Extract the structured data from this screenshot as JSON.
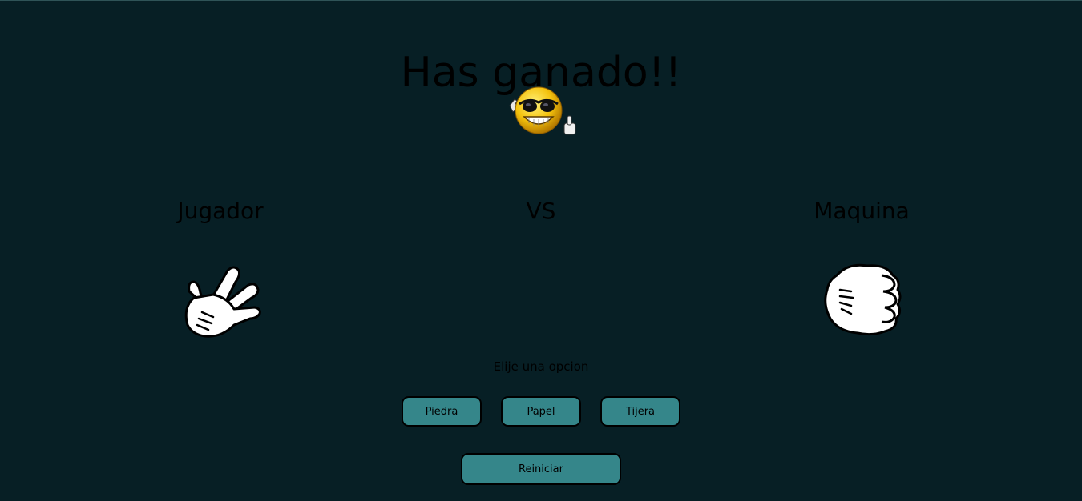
{
  "result": {
    "title": "Has ganado!!",
    "emoji_icon": "cool-sunglasses-thumbs-up-smiley"
  },
  "players": {
    "player_label": "Jugador",
    "vs_label": "VS",
    "machine_label": "Maquina",
    "player_choice_icon": "scissors-hand",
    "machine_choice_icon": "rock-fist-hand"
  },
  "controls": {
    "prompt": "Elije una opcion",
    "options": [
      "Piedra",
      "Papel",
      "Tijera"
    ],
    "restart_label": "Reiniciar"
  },
  "colors": {
    "background": "#071f25",
    "button": "#35868a",
    "text": "#000000"
  }
}
